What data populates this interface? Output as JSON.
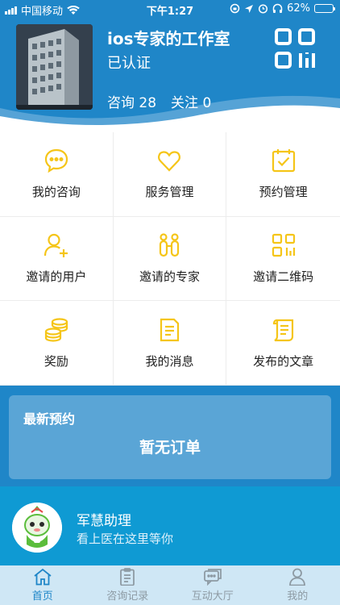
{
  "status_bar": {
    "carrier": "中国移动",
    "time": "下午1:27",
    "battery": "62%",
    "battery_level": 0.62
  },
  "profile": {
    "name": "ios专家的工作室",
    "status": "已认证",
    "consult_label": "咨询",
    "consult_count": "28",
    "follow_label": "关注",
    "follow_count": "0"
  },
  "menu": {
    "items": [
      {
        "label": "我的咨询",
        "icon": "chat-bubble-icon"
      },
      {
        "label": "服务管理",
        "icon": "heart-icon"
      },
      {
        "label": "预约管理",
        "icon": "calendar-check-icon"
      },
      {
        "label": "邀请的用户",
        "icon": "add-user-icon"
      },
      {
        "label": "邀请的专家",
        "icon": "experts-icon"
      },
      {
        "label": "邀请二维码",
        "icon": "qr-code-icon"
      },
      {
        "label": "奖励",
        "icon": "coins-icon"
      },
      {
        "label": "我的消息",
        "icon": "message-doc-icon"
      },
      {
        "label": "发布的文章",
        "icon": "scroll-icon"
      }
    ]
  },
  "appointments": {
    "title": "最新预约",
    "empty_text": "暂无订单"
  },
  "assistant": {
    "name": "军慧助理",
    "description": "看上医在这里等你"
  },
  "tabs": [
    {
      "label": "首页",
      "icon": "home-icon"
    },
    {
      "label": "咨询记录",
      "icon": "clipboard-icon"
    },
    {
      "label": "互动大厅",
      "icon": "chat-hall-icon"
    },
    {
      "label": "我的",
      "icon": "person-icon"
    }
  ],
  "colors": {
    "primary": "#1f86c8",
    "accent": "#f5c518",
    "card": "#5aa5d6",
    "assistant_bg": "#0f9ad3",
    "tab_bg": "#cfe7f5"
  }
}
